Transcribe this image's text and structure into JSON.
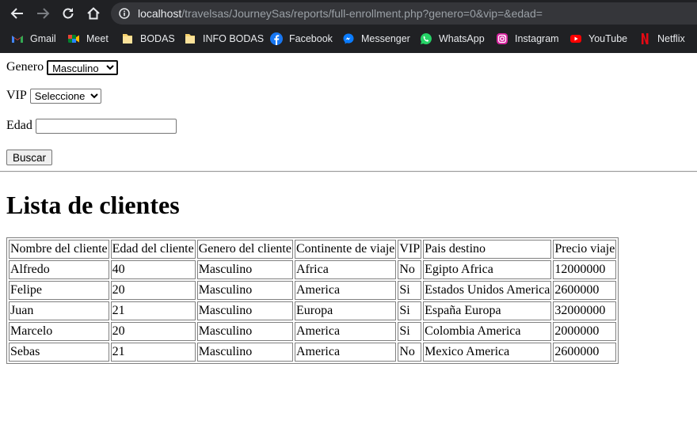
{
  "browser": {
    "url_host": "localhost",
    "url_path": "/travelsas/JourneySas/reports/full-enrollment.php?genero=0&vip=&edad=",
    "icons": {
      "back": "back-arrow-icon",
      "forward": "forward-arrow-icon",
      "reload": "reload-icon",
      "home": "home-icon",
      "info": "info-icon"
    },
    "bookmarks": [
      {
        "label": "Gmail",
        "icon": "gmail-icon"
      },
      {
        "label": "Meet",
        "icon": "meet-icon"
      },
      {
        "label": "BODAS",
        "icon": "folder-icon"
      },
      {
        "label": "INFO BODAS",
        "icon": "folder-icon"
      },
      {
        "label": "Facebook",
        "icon": "facebook-icon"
      },
      {
        "label": "Messenger",
        "icon": "messenger-icon"
      },
      {
        "label": "WhatsApp",
        "icon": "whatsapp-icon"
      },
      {
        "label": "Instagram",
        "icon": "instagram-icon"
      },
      {
        "label": "YouTube",
        "icon": "youtube-icon"
      },
      {
        "label": "Netflix",
        "icon": "netflix-icon"
      }
    ]
  },
  "form": {
    "genero": {
      "label": "Genero",
      "selected": "Masculino"
    },
    "vip": {
      "label": "VIP",
      "selected": "Seleccione"
    },
    "edad": {
      "label": "Edad",
      "value": ""
    },
    "submit_label": "Buscar"
  },
  "report": {
    "title": "Lista de clientes",
    "columns": [
      "Nombre del cliente",
      "Edad del cliente",
      "Genero del cliente",
      "Continente de viaje",
      "VIP",
      "Pais destino",
      "Precio viaje"
    ],
    "rows": [
      [
        "Alfredo",
        "40",
        "Masculino",
        "Africa",
        "No",
        "Egipto Africa",
        "12000000"
      ],
      [
        "Felipe",
        "20",
        "Masculino",
        "America",
        "Si",
        "Estados Unidos America",
        "2600000"
      ],
      [
        "Juan",
        "21",
        "Masculino",
        "Europa",
        "Si",
        "España Europa",
        "32000000"
      ],
      [
        "Marcelo",
        "20",
        "Masculino",
        "America",
        "Si",
        "Colombia America",
        "2000000"
      ],
      [
        "Sebas",
        "21",
        "Masculino",
        "America",
        "No",
        "Mexico America",
        "2600000"
      ]
    ]
  },
  "colors": {
    "chrome_bg": "#202124",
    "omnibox_bg": "#35363a",
    "url_host": "#e8eaed",
    "url_path": "#9aa0a6"
  }
}
